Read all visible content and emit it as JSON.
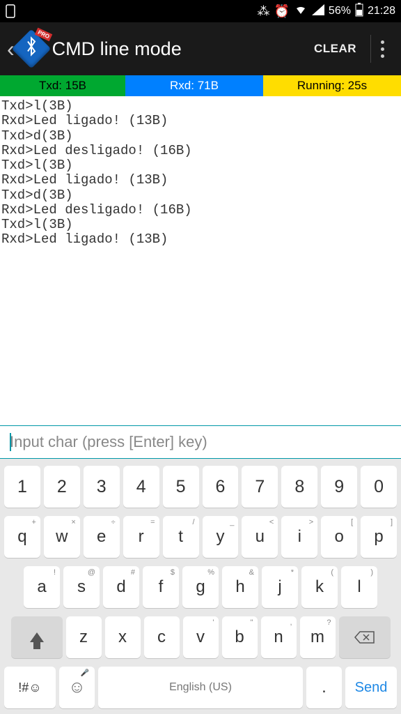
{
  "status_bar": {
    "battery_pct": "56%",
    "time": "21:28"
  },
  "app_bar": {
    "pro_badge": "PRO",
    "title": "CMD line mode",
    "clear": "CLEAR"
  },
  "stats": {
    "txd": "Txd: 15B",
    "rxd": "Rxd: 71B",
    "running": "Running: 25s"
  },
  "terminal_lines": [
    "Txd>l(3B)",
    "Rxd>Led ligado! (13B)",
    "Txd>d(3B)",
    "Rxd>Led desligado! (16B)",
    "Txd>l(3B)",
    "Rxd>Led ligado! (13B)",
    "Txd>d(3B)",
    "Rxd>Led desligado! (16B)",
    "Txd>l(3B)",
    "Rxd>Led ligado! (13B)"
  ],
  "input": {
    "placeholder": "Input char (press [Enter] key)"
  },
  "keyboard": {
    "row1": [
      "1",
      "2",
      "3",
      "4",
      "5",
      "6",
      "7",
      "8",
      "9",
      "0"
    ],
    "row2": {
      "keys": [
        "q",
        "w",
        "e",
        "r",
        "t",
        "y",
        "u",
        "i",
        "o",
        "p"
      ],
      "alts": [
        "+",
        "×",
        "÷",
        "=",
        "/",
        "_",
        "<",
        ">",
        "[",
        "]"
      ]
    },
    "row3": {
      "keys": [
        "a",
        "s",
        "d",
        "f",
        "g",
        "h",
        "j",
        "k",
        "l"
      ],
      "alts": [
        "!",
        "@",
        "#",
        "$",
        "%",
        "&",
        "*",
        "(",
        ")"
      ]
    },
    "row4": {
      "keys": [
        "z",
        "x",
        "c",
        "v",
        "b",
        "n",
        "m"
      ],
      "alts": [
        "",
        "",
        "",
        "'",
        "\"",
        ",",
        "?"
      ]
    },
    "sym": "!#☺",
    "space": "English (US)",
    "dot": ".",
    "send": "Send"
  }
}
